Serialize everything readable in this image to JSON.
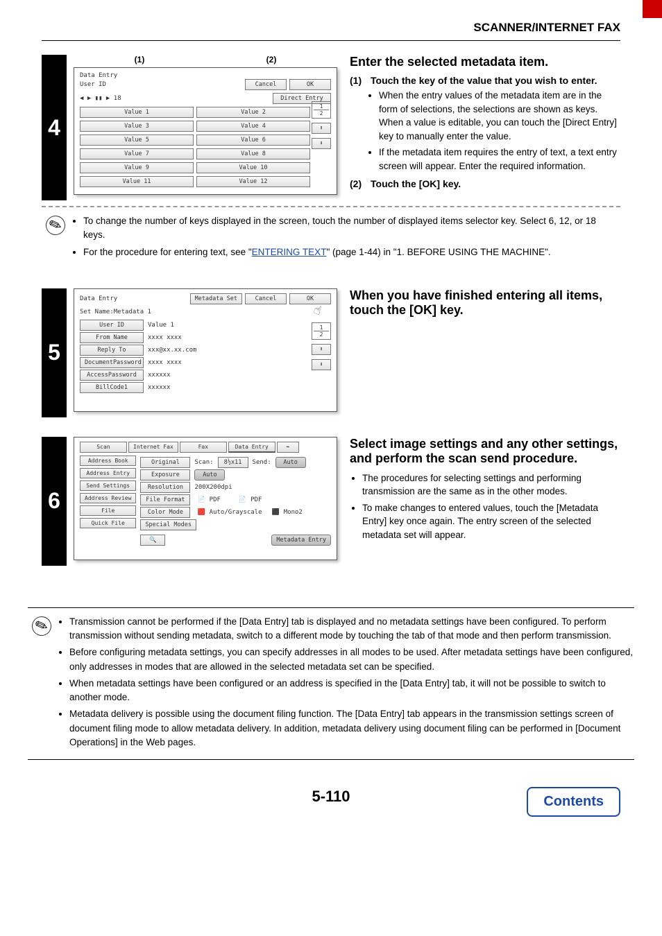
{
  "header": {
    "title": "SCANNER/INTERNET FAX"
  },
  "step4": {
    "number": "4",
    "markers": {
      "m1": "(1)",
      "m2": "(2)"
    },
    "panel": {
      "title": "Data Entry",
      "subtitle": "User ID",
      "cancel": "Cancel",
      "ok": "OK",
      "direct_entry": "Direct Entry",
      "page_selector": "18",
      "values": [
        "Value 1",
        "Value 2",
        "Value 3",
        "Value 4",
        "Value 5",
        "Value 6",
        "Value 7",
        "Value 8",
        "Value 9",
        "Value 10",
        "Value 11",
        "Value 12"
      ],
      "pager_top": "1",
      "pager_bottom": "2",
      "arrow_up": "⬆",
      "arrow_down": "⬇"
    },
    "heading": "Enter the selected metadata item.",
    "sub1": {
      "num": "(1)",
      "text": "Touch the key of the value that you wish to enter."
    },
    "sub1_bullets": [
      "When the entry values of the metadata item are in the form of selections, the selections are shown as keys. When a value is editable, you can touch the [Direct Entry] key to manually enter the value.",
      "If the metadata item requires the entry of text, a text entry screen will appear. Enter the required information."
    ],
    "sub2": {
      "num": "(2)",
      "text": "Touch the [OK] key."
    },
    "note_bullets": [
      "To change the number of keys displayed in the screen, touch the number of displayed items selector key. Select 6, 12, or 18 keys.",
      "For the procedure for entering text, see \"ENTERING TEXT\" (page 1-44) in \"1. BEFORE USING THE MACHINE\"."
    ],
    "link_text": "ENTERING TEXT",
    "note_before_link": "For the procedure for entering text, see \"",
    "note_after_link": "\" (page 1-44) in \"1. BEFORE USING THE MACHINE\"."
  },
  "step5": {
    "number": "5",
    "panel": {
      "title": "Data Entry",
      "metadata_set": "Metadata Set",
      "cancel": "Cancel",
      "ok": "OK",
      "set_name": "Set Name:Metadata 1",
      "rows": [
        {
          "label": "User ID",
          "value": "Value 1"
        },
        {
          "label": "From Name",
          "value": "xxxx xxxx"
        },
        {
          "label": "Reply To",
          "value": "xxx@xx.xx.com"
        },
        {
          "label": "DocumentPassword",
          "value": "xxxx xxxx"
        },
        {
          "label": "AccessPassword",
          "value": "xxxxxx"
        },
        {
          "label": "BillCode1",
          "value": "xxxxxx"
        }
      ],
      "pager_top": "1",
      "pager_bottom": "2"
    },
    "heading": "When you have finished entering all items, touch the [OK] key."
  },
  "step6": {
    "number": "6",
    "panel": {
      "tabs": [
        "Scan",
        "Internet Fax",
        "Fax",
        "Data Entry",
        "➡"
      ],
      "side_buttons": [
        "Address Book",
        "Address Entry",
        "Send Settings",
        "Address Review",
        "File",
        "Quick File"
      ],
      "rows": {
        "original": {
          "label": "Original",
          "scan_label": "Scan:",
          "scan_val": "8½x11",
          "send_label": "Send:",
          "send_val": "Auto"
        },
        "exposure": {
          "label": "Exposure",
          "value": "Auto"
        },
        "resolution": {
          "label": "Resolution",
          "value": "200X200dpi"
        },
        "file_format": {
          "label": "File Format",
          "v1": "PDF",
          "v2": "PDF"
        },
        "color_mode": {
          "label": "Color Mode",
          "v1": "Auto/Grayscale",
          "v2": "Mono2"
        },
        "special_modes": {
          "label": "Special Modes"
        }
      },
      "footer_button": "Metadata Entry"
    },
    "heading": "Select image settings and any other settings, and perform the scan send procedure.",
    "bullets": [
      "The procedures for selecting settings and performing transmission are the same as in the other modes.",
      "To make changes to entered values, touch the [Metadata Entry] key once again. The entry screen of the selected metadata set will appear."
    ]
  },
  "bottom_notes": [
    "Transmission cannot be performed if the [Data Entry] tab is displayed and no metadata settings have been configured. To perform transmission without sending metadata, switch to a different mode by touching the tab of that mode and then perform transmission.",
    "Before configuring metadata settings, you can specify addresses in all modes to be used. After metadata settings have been configured, only addresses in modes that are allowed in the selected metadata set can be specified.",
    "When metadata settings have been configured or an address is specified in the [Data Entry] tab, it will not be possible to switch to another mode.",
    "Metadata delivery is possible using the document filing function. The [Data Entry] tab appears in the transmission settings screen of document filing mode to allow metadata delivery. In addition, metadata delivery using document filing can be performed in [Document Operations] in the Web pages."
  ],
  "footer": {
    "page_number": "5-110",
    "contents": "Contents"
  }
}
